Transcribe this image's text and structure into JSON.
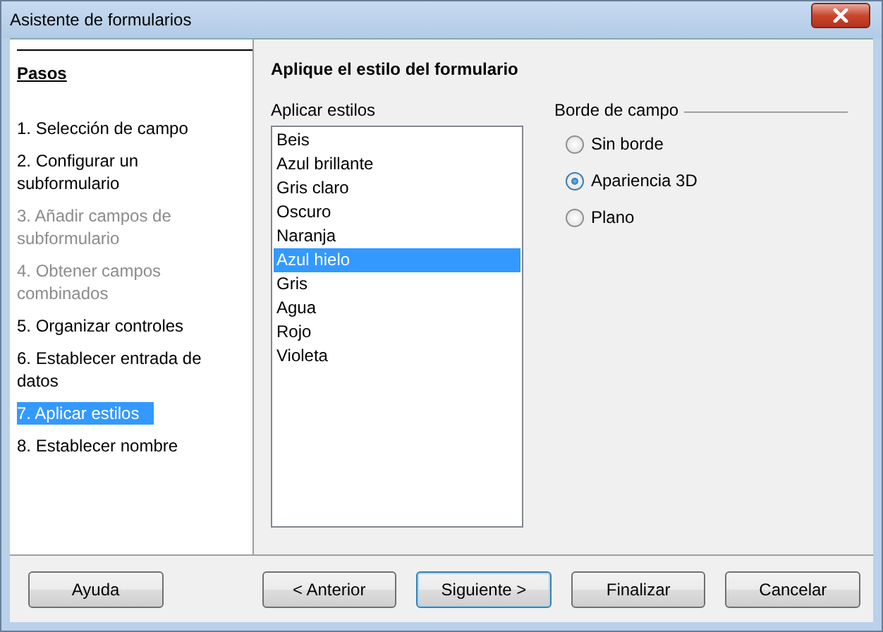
{
  "window": {
    "title": "Asistente de formularios"
  },
  "sidebar": {
    "heading": "Pasos",
    "items": [
      {
        "label": "1. Selección de campo",
        "disabled": false,
        "selected": false
      },
      {
        "label": "2. Configurar un subformulario",
        "disabled": false,
        "selected": false
      },
      {
        "label": "3. Añadir campos de subformulario",
        "disabled": true,
        "selected": false
      },
      {
        "label": "4. Obtener campos combinados",
        "disabled": true,
        "selected": false
      },
      {
        "label": "5. Organizar controles",
        "disabled": false,
        "selected": false
      },
      {
        "label": "6. Establecer entrada de datos",
        "disabled": false,
        "selected": false
      },
      {
        "label": "7. Aplicar estilos",
        "disabled": false,
        "selected": true
      },
      {
        "label": "8. Establecer nombre",
        "disabled": false,
        "selected": false
      }
    ]
  },
  "page": {
    "heading": "Aplique el estilo del formulario",
    "styles": {
      "label": "Aplicar estilos",
      "items": [
        {
          "label": "Beis",
          "selected": false
        },
        {
          "label": "Azul brillante",
          "selected": false
        },
        {
          "label": "Gris claro",
          "selected": false
        },
        {
          "label": "Oscuro",
          "selected": false
        },
        {
          "label": "Naranja",
          "selected": false
        },
        {
          "label": "Azul hielo",
          "selected": true
        },
        {
          "label": "Gris",
          "selected": false
        },
        {
          "label": "Agua",
          "selected": false
        },
        {
          "label": "Rojo",
          "selected": false
        },
        {
          "label": "Violeta",
          "selected": false
        }
      ]
    },
    "border": {
      "label": "Borde de campo",
      "options": [
        {
          "label": "Sin borde",
          "selected": false
        },
        {
          "label": "Apariencia 3D",
          "selected": true
        },
        {
          "label": "Plano",
          "selected": false
        }
      ]
    }
  },
  "buttons": [
    {
      "label": "Ayuda",
      "default": false
    },
    {
      "label": "< Anterior",
      "default": false
    },
    {
      "label": "Siguiente >",
      "default": true
    },
    {
      "label": "Finalizar",
      "default": false
    },
    {
      "label": "Cancelar",
      "default": false
    }
  ]
}
